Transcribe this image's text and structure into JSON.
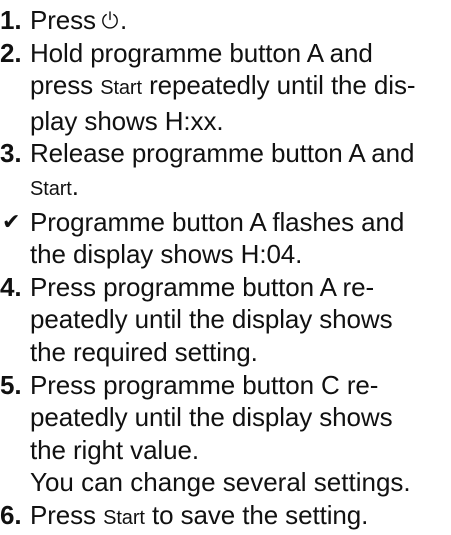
{
  "steps": [
    {
      "marker": "1.",
      "segments": [
        {
          "text": "Press"
        }
      ],
      "trailing_icon": "power-icon",
      "after_icon": "."
    },
    {
      "marker": "2.",
      "segments": [
        {
          "text": "Hold programme button A and\npress "
        },
        {
          "text": "Start",
          "small": true
        },
        {
          "text": " repeatedly until the dis-\nplay shows H:xx."
        }
      ]
    },
    {
      "marker": "3.",
      "segments": [
        {
          "text": "Release programme button A and\n"
        },
        {
          "text": "Start",
          "small": true
        },
        {
          "text": "."
        }
      ]
    },
    {
      "marker": "✔",
      "result": true,
      "segments": [
        {
          "text": "Programme button A flashes and\nthe display shows H:04."
        }
      ]
    },
    {
      "marker": "4.",
      "segments": [
        {
          "text": "Press programme button A re-\npeatedly until the display shows\nthe required setting."
        }
      ]
    },
    {
      "marker": "5.",
      "segments": [
        {
          "text": "Press programme button C re-\npeatedly until the display shows\nthe right value."
        }
      ]
    },
    {
      "note": "You can change several settings."
    },
    {
      "marker": "6.",
      "segments": [
        {
          "text": "Press "
        },
        {
          "text": "Start",
          "small": true
        },
        {
          "text": " to save the setting."
        }
      ]
    }
  ]
}
